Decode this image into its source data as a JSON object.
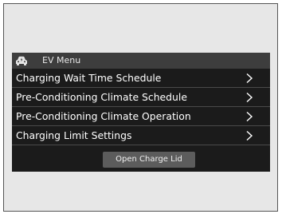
{
  "header": {
    "icon": "ev-car-icon",
    "title": "EV Menu"
  },
  "menu": {
    "items": [
      {
        "label": "Charging Wait Time Schedule",
        "icon": "chevron-right-icon"
      },
      {
        "label": "Pre-Conditioning Climate Schedule",
        "icon": "chevron-right-icon"
      },
      {
        "label": "Pre-Conditioning Climate Operation",
        "icon": "chevron-right-icon"
      },
      {
        "label": "Charging Limit Settings",
        "icon": "chevron-right-icon"
      }
    ]
  },
  "actions": {
    "open_charge_lid_label": "Open Charge Lid"
  },
  "colors": {
    "screen_background": "#1b1b1b",
    "title_bar": "#3d3d3d",
    "divider": "#4a4a4a",
    "button": "#5c5c5c",
    "text": "#ffffff"
  }
}
